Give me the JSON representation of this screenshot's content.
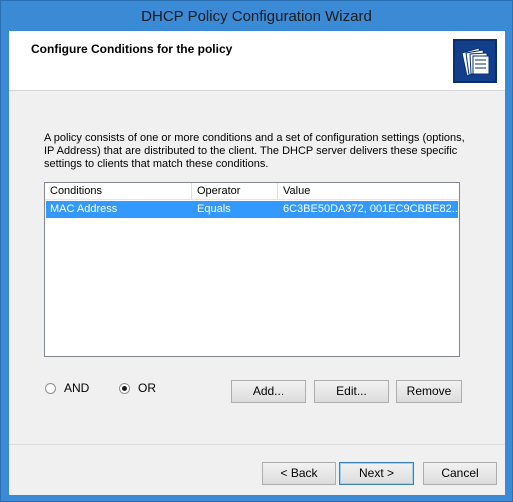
{
  "window": {
    "title": "DHCP Policy Configuration Wizard"
  },
  "header": {
    "title": "Configure Conditions for the policy",
    "icon": "folder-documents-icon"
  },
  "description": "A policy consists of one or more conditions and a set of configuration settings (options, IP Address) that are distributed to the client. The DHCP server delivers these specific settings to clients that match these conditions.",
  "conditions_table": {
    "columns": [
      "Conditions",
      "Operator",
      "Value"
    ],
    "rows": [
      {
        "condition": "MAC Address",
        "operator": "Equals",
        "value": "6C3BE50DA372, 001EC9CBBE82...",
        "selected": true
      }
    ]
  },
  "logic": {
    "and_label": "AND",
    "or_label": "OR",
    "selected": "OR"
  },
  "buttons": {
    "add": "Add...",
    "edit": "Edit...",
    "remove": "Remove",
    "back": "< Back",
    "next": "Next >",
    "cancel": "Cancel"
  },
  "colors": {
    "window_frame": "#3a8ad6",
    "selection": "#3399ff"
  }
}
